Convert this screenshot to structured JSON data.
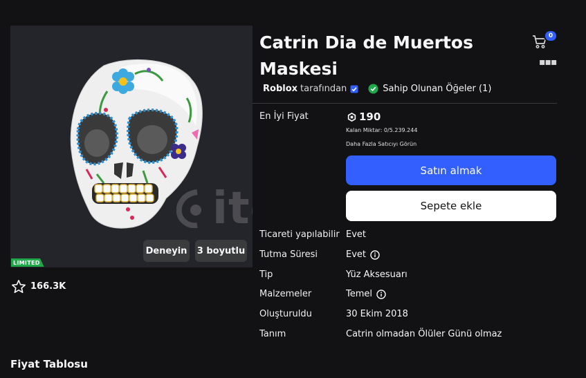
{
  "item": {
    "title_line1": "Catrin Dia de Muertos",
    "title_line2": "Maskesi",
    "creator": "Roblox",
    "creator_suffix": "tarafından",
    "owned_label": "Sahip Olunan Öğeler (1)"
  },
  "thumbnail": {
    "badge": "LIMITED",
    "try_label": "Deneyin",
    "three_d_label": "3 boyutlu",
    "watermark": "itemsatis",
    "favorites": "166.3K"
  },
  "header": {
    "cart_count": "0",
    "more_glyph": "▪▪▪"
  },
  "pricing": {
    "best_price_label": "En İyi Fiyat",
    "price": "190",
    "remaining": "Kalan Miktar: 0/5.239.244",
    "see_more_sellers": "Daha Fazla Satıcıyı Görün",
    "buy_label": "Satın almak",
    "add_to_cart_label": "Sepete ekle"
  },
  "details": [
    {
      "label": "Ticareti yapılabilir",
      "value": "Evet",
      "info": false
    },
    {
      "label": "Tutma Süresi",
      "value": "Evet",
      "info": true
    },
    {
      "label": "Tip",
      "value": "Yüz Aksesuarı",
      "info": false
    },
    {
      "label": "Malzemeler",
      "value": "Temel",
      "info": true
    },
    {
      "label": "Oluşturuldu",
      "value": "30 Ekim 2018",
      "info": false
    },
    {
      "label": "Tanım",
      "value": "Catrin olmadan Ölüler Günü olmaz",
      "info": false
    }
  ],
  "sections": {
    "price_chart_title": "Fiyat Tablosu"
  },
  "colors": {
    "background": "#121215",
    "accent": "#335fff",
    "limited_green": "#1ea84a"
  }
}
